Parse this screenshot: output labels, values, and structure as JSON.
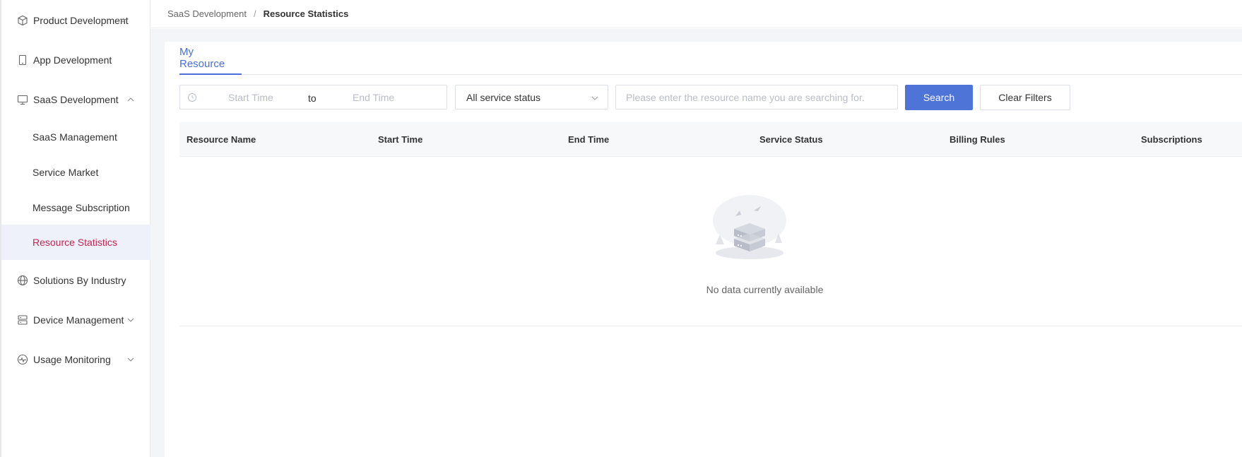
{
  "sidebar": {
    "items": [
      {
        "label": "Product Development",
        "icon": "cube-icon",
        "expanded": false
      },
      {
        "label": "App Development",
        "icon": "mobile-icon"
      },
      {
        "label": "SaaS Development",
        "icon": "monitor-icon",
        "expanded": true,
        "children": [
          {
            "label": "SaaS Management"
          },
          {
            "label": "Service Market"
          },
          {
            "label": "Message Subscription"
          },
          {
            "label": "Resource Statistics",
            "active": true
          }
        ]
      },
      {
        "label": "Solutions By Industry",
        "icon": "globe-icon"
      },
      {
        "label": "Device Management",
        "icon": "server-icon",
        "expanded": false
      },
      {
        "label": "Usage Monitoring",
        "icon": "pulse-icon",
        "expanded": false
      }
    ]
  },
  "breadcrumb": {
    "parent": "SaaS Development",
    "separator": "/",
    "current": "Resource Statistics"
  },
  "tabs": [
    {
      "label": "My Resource",
      "active": true
    }
  ],
  "filters": {
    "start_placeholder": "Start Time",
    "range_separator": "to",
    "end_placeholder": "End Time",
    "status_select": "All service status",
    "search_placeholder": "Please enter the resource name you are searching for.",
    "search_button": "Search",
    "clear_button": "Clear Filters"
  },
  "table": {
    "columns": [
      "Resource Name",
      "Start Time",
      "End Time",
      "Service Status",
      "Billing Rules",
      "Subscriptions"
    ],
    "rows": [],
    "empty_text": "No data currently available"
  },
  "colors": {
    "accent": "#4f74d8",
    "active_text": "#c0284e",
    "active_bg": "#eef0fa"
  }
}
